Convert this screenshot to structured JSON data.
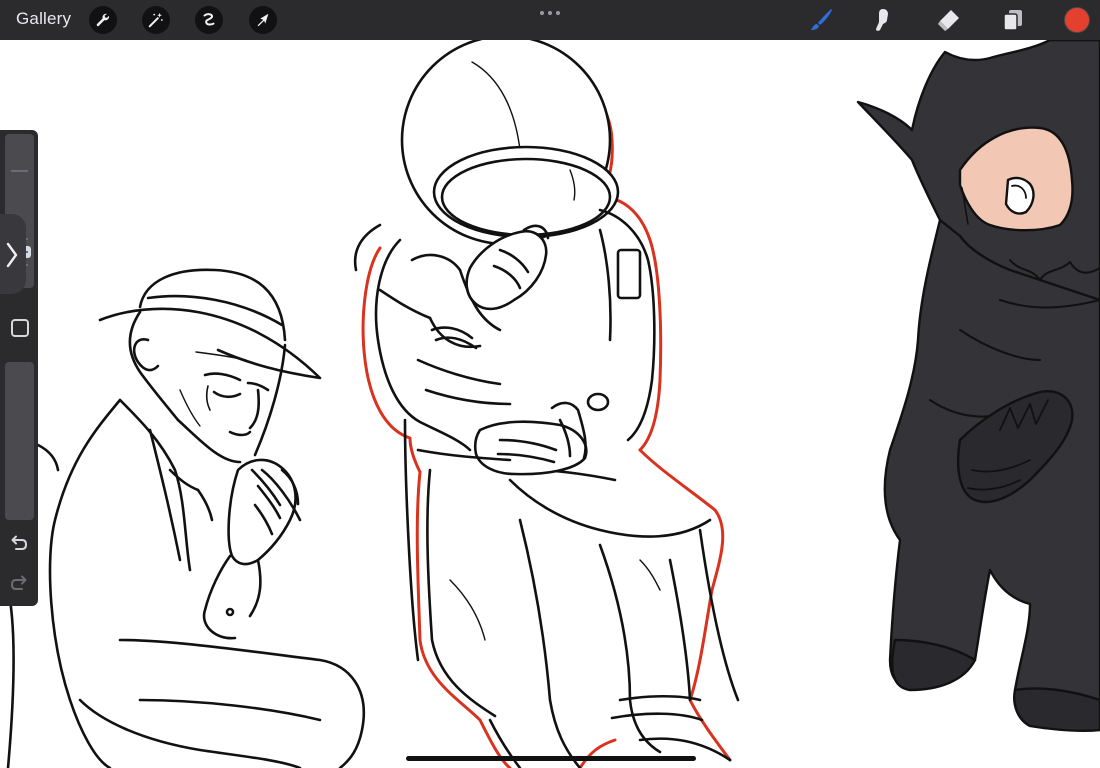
{
  "toolbar": {
    "gallery_label": "Gallery",
    "left_tools": [
      "wrench-icon",
      "magic-wand-icon",
      "selection-icon",
      "move-arrow-icon"
    ],
    "right_tools": [
      "brush-icon",
      "smudge-icon",
      "eraser-icon",
      "layers-icon"
    ],
    "active_tool": "brush-icon",
    "accent_color": "#2f6fd8",
    "current_color": "#e4402f"
  },
  "sidebar": {
    "brush_size_level": 0.15,
    "opacity_level": 0.5,
    "undo_icon": "undo-icon",
    "redo_icon": "redo-icon"
  },
  "canvas": {
    "background": "#ffffff",
    "outline_accent": "#d9331f",
    "figure_fill": "#333338"
  }
}
